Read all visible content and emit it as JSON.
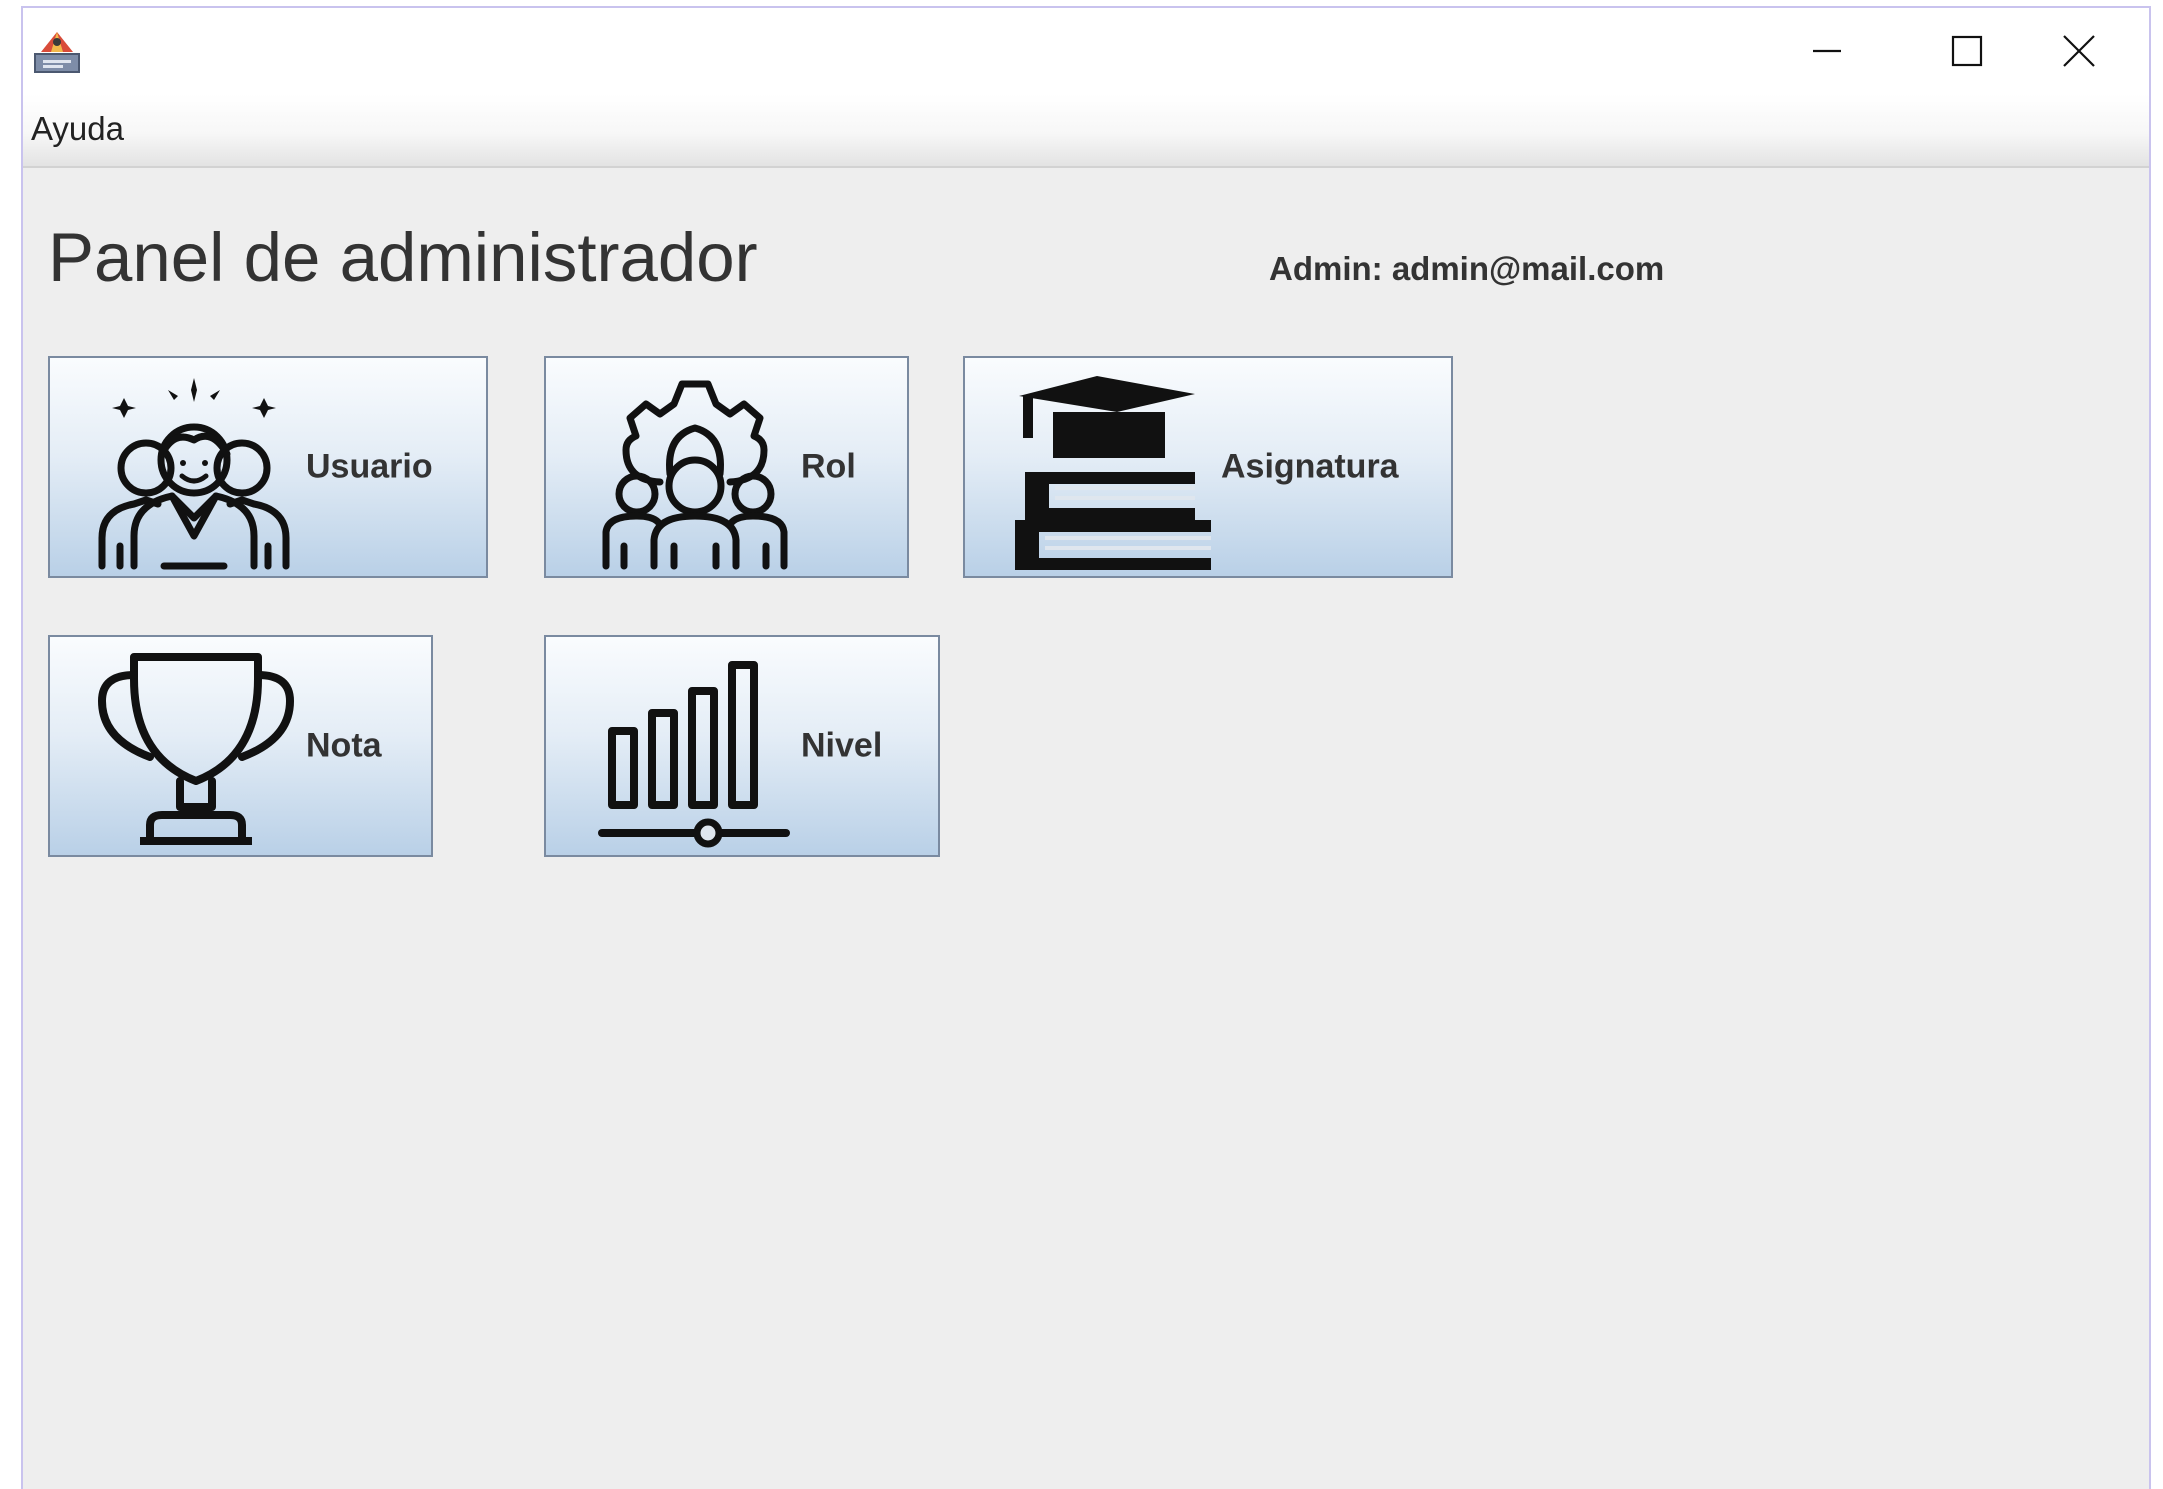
{
  "window": {
    "menu": [
      {
        "label": "Ayuda"
      }
    ],
    "controls": [
      "minimize",
      "maximize",
      "close"
    ]
  },
  "panel": {
    "title": "Panel de administrador",
    "admin_label": "Admin: admin@mail.com"
  },
  "tiles": [
    {
      "label": "Usuario",
      "icon": "users-team-icon"
    },
    {
      "label": "Rol",
      "icon": "role-gear-team-icon"
    },
    {
      "label": "Asignatura",
      "icon": "graduation-books-icon"
    },
    {
      "label": "Nota",
      "icon": "trophy-icon"
    },
    {
      "label": "Nivel",
      "icon": "level-bars-icon"
    }
  ],
  "colors": {
    "window_background": "#eeeeee",
    "window_border": "#c9c3ee",
    "tile_border": "#7a8aa0",
    "tile_gradient_top": "#fafcfe",
    "tile_gradient_bottom": "#b9d0e7",
    "text": "#333333"
  }
}
